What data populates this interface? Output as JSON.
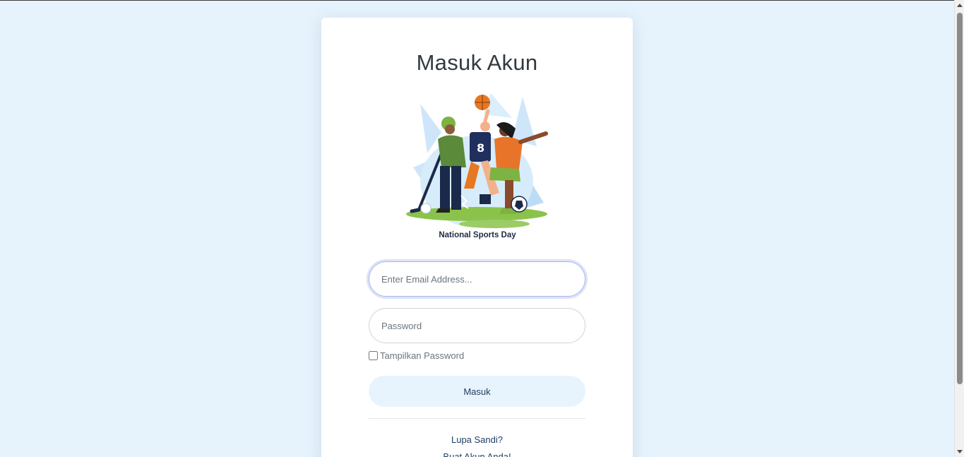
{
  "login": {
    "title": "Masuk Akun",
    "illustration_caption": "National Sports Day",
    "email_placeholder": "Enter Email Address...",
    "password_placeholder": "Password",
    "show_password_label": "Tampilkan Password",
    "submit_label": "Masuk",
    "forgot_password_link": "Lupa Sandi?",
    "create_account_link": "Buat Akun Anda!"
  },
  "icons": {
    "illustration": "sports-players-illustration",
    "scroll_up": "scroll-up-arrow-icon",
    "scroll_down": "scroll-down-arrow-icon"
  },
  "colors": {
    "page_background": "#e6f3fd",
    "card_background": "#ffffff",
    "button_background": "#e8f4fd",
    "link_color": "#1e3f66",
    "focus_ring": "#a9b9f0"
  }
}
